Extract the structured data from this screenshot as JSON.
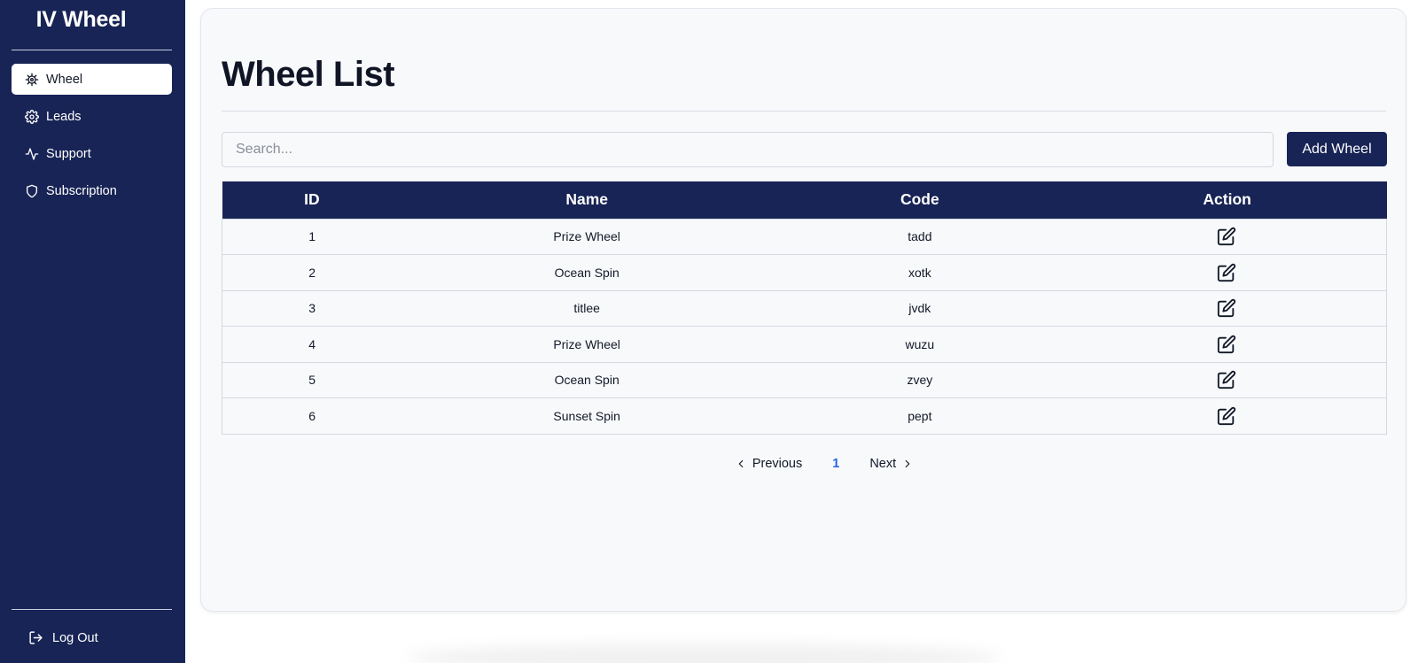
{
  "app": {
    "brand": "IV Wheel"
  },
  "sidebar": {
    "items": [
      {
        "label": "Wheel",
        "icon": "helm-icon",
        "active": true
      },
      {
        "label": "Leads",
        "icon": "gear-icon",
        "active": false
      },
      {
        "label": "Support",
        "icon": "activity-icon",
        "active": false
      },
      {
        "label": "Subscription",
        "icon": "shield-icon",
        "active": false
      }
    ],
    "logout_label": "Log Out"
  },
  "main": {
    "title": "Wheel List",
    "search_placeholder": "Search...",
    "add_button_label": "Add Wheel",
    "table": {
      "columns": [
        "ID",
        "Name",
        "Code",
        "Action"
      ],
      "rows": [
        {
          "id": "1",
          "name": "Prize Wheel",
          "code": "tadd"
        },
        {
          "id": "2",
          "name": "Ocean Spin",
          "code": "xotk"
        },
        {
          "id": "3",
          "name": "titlee",
          "code": "jvdk"
        },
        {
          "id": "4",
          "name": "Prize Wheel",
          "code": "wuzu"
        },
        {
          "id": "5",
          "name": "Ocean Spin",
          "code": "zvey"
        },
        {
          "id": "6",
          "name": "Sunset Spin",
          "code": "pept"
        }
      ]
    },
    "pagination": {
      "previous_label": "Previous",
      "current_page": "1",
      "next_label": "Next"
    }
  },
  "colors": {
    "sidebar_bg": "#182455",
    "accent": "#182455",
    "link": "#2563eb",
    "card_bg": "#f8f9fb"
  }
}
